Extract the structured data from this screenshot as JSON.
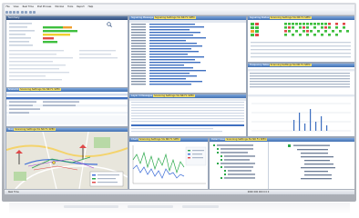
{
  "menu": {
    "items": [
      "File",
      "View",
      "Real Time",
      "Post Process",
      "Window",
      "Tools",
      "Report",
      "Help"
    ]
  },
  "panels": {
    "topleft": {
      "title": "Summary"
    },
    "midleft": {
      "title": "Scenario",
      "highlight": "Scanning Settings 5G NR F1 SPEC"
    },
    "topmid": {
      "title": "Signaling Message",
      "highlight": "Signaling Settings 5G NR F1 SPEC"
    },
    "center": {
      "title": "Layer 3 Messages",
      "highlight": "Scanning Settings 5G NR F1 SPEC"
    },
    "topright": {
      "title": "Signaling Status",
      "highlight": "Scanning Settings 5G NR F1 SPEC"
    },
    "midright": {
      "title": "Frequency Table",
      "highlight": "Scanning Settings 5G NR F1 SPEC"
    },
    "map": {
      "title": "Map",
      "highlight": "Scanning Settings 5G NR F1 SPEC"
    },
    "chart": {
      "title": "Chart",
      "highlight": "Scanning Settings 5G NR F1 SPEC"
    },
    "tree": {
      "title": "Detail View",
      "highlight": "Scanning Settings 5G NR F1 SPEC"
    }
  },
  "colors": {
    "title_bar": "#3f6fb2",
    "highlight": "#f2e06a",
    "selection": "#3e6fc0",
    "green": "#3fbf3f",
    "red": "#e04848",
    "orange": "#f0a030"
  },
  "icons": [
    "search-icon",
    "grid-icon",
    "list-icon",
    "settings-icon"
  ],
  "status": {
    "left": "Real Time",
    "right": "0000 000 000 0 0 0"
  }
}
